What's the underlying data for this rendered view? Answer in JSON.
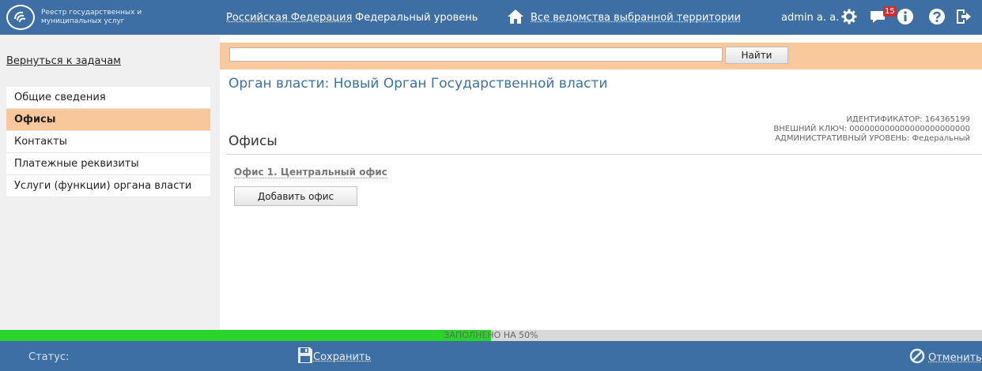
{
  "header": {
    "logo_text": "Реестр государственных и муниципальных услуг",
    "nav": {
      "territory": "Российская Федерация",
      "level": "Федеральный уровень",
      "departments": "Все ведомства выбранной территории"
    },
    "user": "admin a. a.",
    "notification_count": "15",
    "icons": [
      "settings-icon",
      "messages-icon",
      "info-icon",
      "help-icon",
      "logout-icon"
    ],
    "color": "#3d6fa5"
  },
  "sidebar": {
    "back_link": "Вернуться к задачам",
    "items": [
      {
        "label": "Общие сведения",
        "active": false
      },
      {
        "label": "Офисы",
        "active": true
      },
      {
        "label": "Контакты",
        "active": false
      },
      {
        "label": "Платежные реквизиты",
        "active": false
      },
      {
        "label": "Услуги (функции) органа власти",
        "active": false
      }
    ]
  },
  "search": {
    "value": "",
    "button_label": "Найти"
  },
  "main": {
    "org_title": "Орган власти: Новый Орган Государственной власти",
    "identifier": "ИДЕНТИФИКАТОР: 164365199",
    "external_key": "ВНЕШНИЙ КЛЮЧ: 000000000000000000000000",
    "admin_level": "АДМИНИСТРАТИВНЫЙ УРОВЕНЬ: Федеральный",
    "section_title": "Офисы",
    "office_link": "Офис 1. Центральный офис",
    "add_button": "Добавить офис"
  },
  "progress": {
    "label": "ЗАПОЛНЕНО НА 50%",
    "percent": 50,
    "fill_color": "#2bd42b"
  },
  "footer": {
    "status_label": "Статус:",
    "save_label": "Сохранить",
    "cancel_label": "Отменить"
  }
}
